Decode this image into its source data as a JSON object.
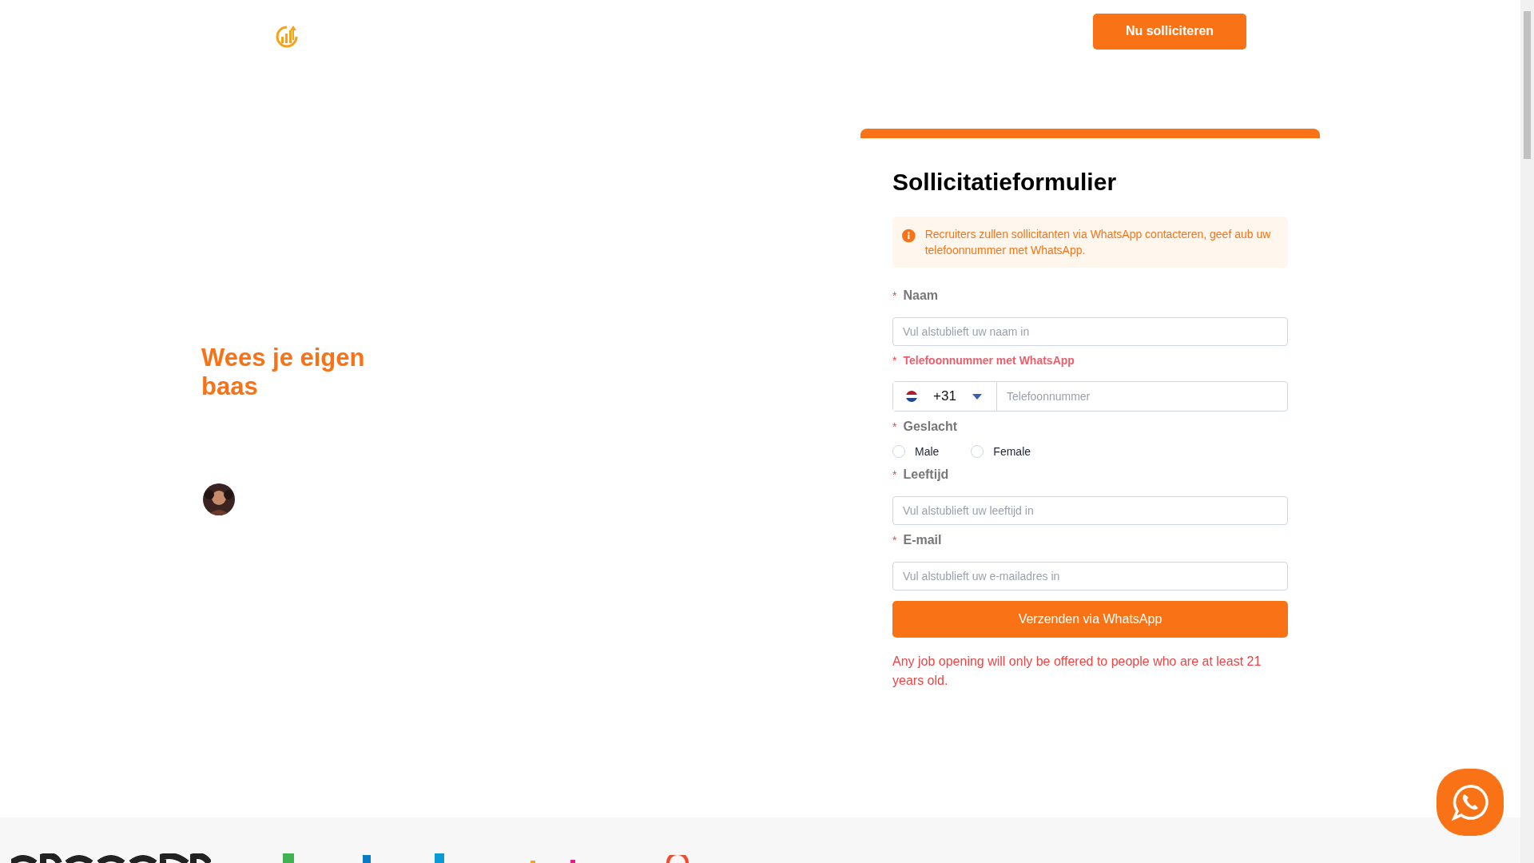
{
  "header": {
    "cta": "Nu solliciteren"
  },
  "hero": {
    "heading": "Wees je eigen baas"
  },
  "form": {
    "title": "Sollicitatieformulier",
    "notice": "Recruiters zullen sollicitanten via WhatsApp contacteren, geef aub uw telefoonnummer met WhatsApp.",
    "fields": [
      {
        "kind": "text",
        "required_mark": "*",
        "label": "Naam",
        "placeholder": "Vul alstublieft uw naam in"
      },
      {
        "kind": "phone",
        "required_mark": "*",
        "label": "Telefoonnummer met WhatsApp",
        "code": "+31",
        "placeholder": "Telefoonnummer"
      },
      {
        "kind": "radio",
        "required_mark": "*",
        "label": "Geslacht",
        "options": [
          {
            "label": "Male",
            "selected": false
          },
          {
            "label": "Female",
            "selected": false
          }
        ]
      },
      {
        "kind": "text",
        "required_mark": "*",
        "label": "Leeftijd",
        "placeholder": "Vul alstublieft uw leeftijd in"
      },
      {
        "kind": "text",
        "required_mark": "*",
        "label": "E-mail",
        "placeholder": "Vul alstublieft uw e-mailadres in"
      }
    ],
    "submit": "Verzenden via WhatsApp",
    "footnote": "Any job opening will only be offered to people who are at least 21 years old."
  }
}
